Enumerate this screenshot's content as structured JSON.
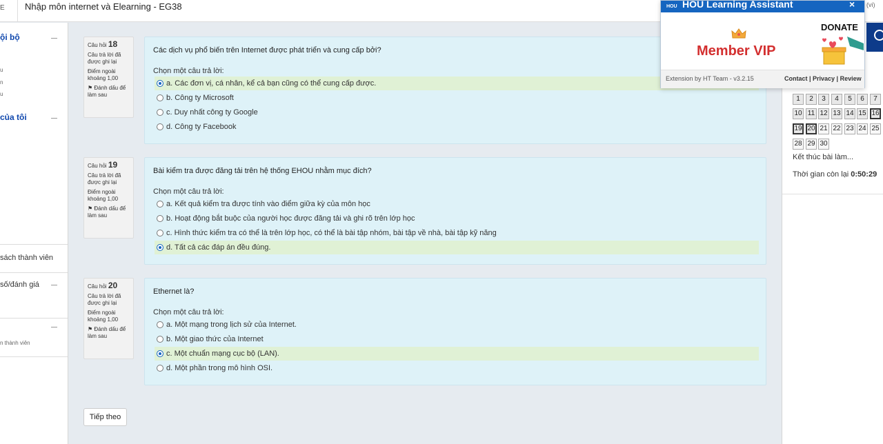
{
  "header": {
    "menu_fragment": "E",
    "course_title": "Nhập môn internet và Elearning - EG38",
    "lang": "(vi)"
  },
  "drawer": {
    "section1_title": "ội bộ",
    "section1_subitems": [
      "",
      "u",
      "n",
      "u"
    ],
    "section2_title": "của tôi",
    "member_list": "sách thành viên",
    "grades": "số/đánh giá",
    "members": "n thành viên"
  },
  "questions": [
    {
      "label": "Câu hỏi",
      "number": "18",
      "status": "Câu trả lời đã được ghi lại",
      "mark": "Điểm ngoài khoảng 1,00",
      "flag": "Đánh dấu để làm sau",
      "text": "Các dịch vụ phổ biến trên Internet được phát triển và cung cấp bởi?",
      "prompt": "Chọn một câu trả lời:",
      "options": [
        "a. Các đơn vị, cá nhân, kể cả bạn cũng có thể cung cấp được.",
        "b. Công ty Microsoft",
        "c. Duy nhất công ty Google",
        "d. Công ty Facebook"
      ],
      "selected": 0
    },
    {
      "label": "Câu hỏi",
      "number": "19",
      "status": "Câu trả lời đã được ghi lại",
      "mark": "Điểm ngoài khoảng 1,00",
      "flag": "Đánh dấu để làm sau",
      "text": "Bài kiểm tra được đăng tải trên hệ thống EHOU nhằm mục đích?",
      "prompt": "Chọn một câu trả lời:",
      "options": [
        "a. Kết quả kiểm tra được tính vào điểm giữa kỳ của môn học",
        "b. Hoạt động bắt buộc của người học được đăng tải và ghi rõ trên lớp học",
        "c. Hình thức kiểm tra có thể là trên lớp học, có thể là bài tập nhóm, bài tập về nhà, bài tập kỹ năng",
        "d. Tất cả các đáp án đều đúng."
      ],
      "selected": 3
    },
    {
      "label": "Câu hỏi",
      "number": "20",
      "status": "Câu trả lời đã được ghi lại",
      "mark": "Điểm ngoài khoảng 1,00",
      "flag": "Đánh dấu để làm sau",
      "text": "Ethernet là?",
      "prompt": "Chọn một câu trả lời:",
      "options": [
        "a. Một mạng trong lịch sử của Internet.",
        "b. Một giao thức của Internet",
        "c. Một chuẩn mạng cục bộ (LAN).",
        "d. Một phần trong mô hình OSI."
      ],
      "selected": 2
    }
  ],
  "next_button": "Tiếp theo",
  "quiz_nav": {
    "buttons": [
      "1",
      "2",
      "3",
      "4",
      "5",
      "6",
      "7",
      "10",
      "11",
      "12",
      "13",
      "14",
      "15",
      "16",
      "19",
      "20",
      "21",
      "22",
      "23",
      "24",
      "25",
      "28",
      "29",
      "30"
    ],
    "current": [
      "16",
      "19",
      "20"
    ],
    "finish": "Kết thúc bài làm...",
    "timer_label": "Thời gian còn lại",
    "timer_value": "0:50:29"
  },
  "extension": {
    "logo": "HOU",
    "title": "HOU Learning Assistant",
    "close": "×",
    "vip": "Member VIP",
    "donate": "DONATE",
    "by": "Extension by HT Team - v3.2.15",
    "links": "Contact | Privacy | Review"
  },
  "colors": {
    "accent": "#1565c0",
    "card_bg": "#def2f8",
    "selected_bg": "#e0f1d5",
    "vip": "#d32f2f"
  }
}
